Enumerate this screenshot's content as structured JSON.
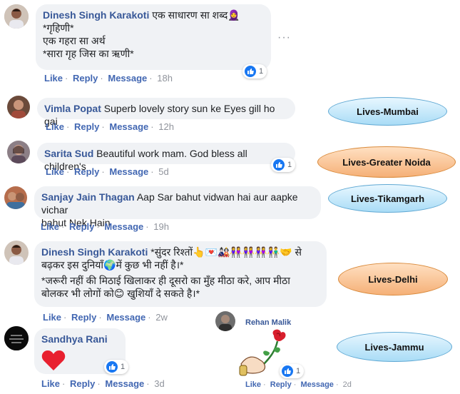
{
  "comments": [
    {
      "name": "Dinesh Singh Karakoti",
      "lines": [
        "एक साधारण सा शब्द🧕",
        "*गृहिणी*",
        "एक गहरा सा अर्थ",
        "*सारा गृह जिस का ऋणी*"
      ],
      "like": "Like",
      "reply": "Reply",
      "message": "Message",
      "time": "18h",
      "reactions": "1"
    },
    {
      "name": "Vimla Popat",
      "text": "Superb lovely story sun ke Eyes gill ho gai",
      "like": "Like",
      "reply": "Reply",
      "message": "Message",
      "time": "12h"
    },
    {
      "name": "Sarita Sud",
      "text": "Beautiful work mam. God bless all children's",
      "like": "Like",
      "reply": "Reply",
      "message": "Message",
      "time": "5d",
      "reactions": "1"
    },
    {
      "name": "Sanjay Jain Thagan",
      "text": "Aap Sar bahut vidwan hai aur aapke vichar",
      "text2": "bahut Nek Hain",
      "like": "Like",
      "reply": "Reply",
      "message": "Message",
      "time": "19h"
    },
    {
      "name": "Dinesh Singh Karakoti",
      "lines": [
        "*सुंदर रिश्तों👆💌🎎👭👭👭👫🤝 से",
        "बढ़कर इस दुनियाँ🌍में कुछ भी नहीं है।*",
        "*जरूरी नहीं की मिठाई खिलाकर ही दूसरो का मुँह मीठा करे, आप मीठा",
        "बोलकर भी लोगों को😊 खुशियाँ दे सकते है।*"
      ],
      "like": "Like",
      "reply": "Reply",
      "message": "Message",
      "time": "2w"
    },
    {
      "name": "Sandhya Rani",
      "emoji": "❤️",
      "like": "Like",
      "reply": "Reply",
      "message": "Message",
      "time": "3d",
      "reactions": "1"
    },
    {
      "name": "Rehan Malik",
      "like": "Like",
      "reply": "Reply",
      "message": "Message",
      "time": "2d",
      "reactions": "1"
    }
  ],
  "labels": {
    "mumbai": "Lives-Mumbai",
    "noida": "Lives-Greater Noida",
    "tikamgarh": "Lives-Tikamgarh",
    "delhi": "Lives-Delhi",
    "jammu": "Lives-Jammu"
  },
  "more_options": "···",
  "colors": {
    "link": "#385898",
    "action": "#4267b2",
    "bubble": "#f0f2f5",
    "like_blue": "#1877f2"
  }
}
